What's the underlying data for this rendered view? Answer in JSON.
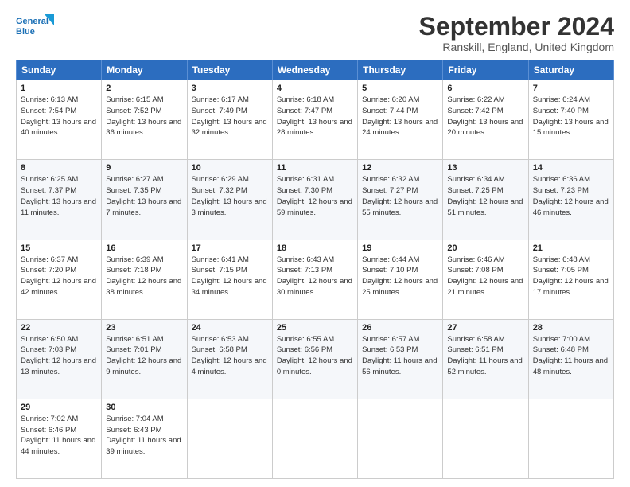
{
  "logo": {
    "line1": "General",
    "line2": "Blue"
  },
  "title": "September 2024",
  "location": "Ranskill, England, United Kingdom",
  "weekdays": [
    "Sunday",
    "Monday",
    "Tuesday",
    "Wednesday",
    "Thursday",
    "Friday",
    "Saturday"
  ],
  "weeks": [
    [
      {
        "day": "1",
        "sunrise": "Sunrise: 6:13 AM",
        "sunset": "Sunset: 7:54 PM",
        "daylight": "Daylight: 13 hours and 40 minutes."
      },
      {
        "day": "2",
        "sunrise": "Sunrise: 6:15 AM",
        "sunset": "Sunset: 7:52 PM",
        "daylight": "Daylight: 13 hours and 36 minutes."
      },
      {
        "day": "3",
        "sunrise": "Sunrise: 6:17 AM",
        "sunset": "Sunset: 7:49 PM",
        "daylight": "Daylight: 13 hours and 32 minutes."
      },
      {
        "day": "4",
        "sunrise": "Sunrise: 6:18 AM",
        "sunset": "Sunset: 7:47 PM",
        "daylight": "Daylight: 13 hours and 28 minutes."
      },
      {
        "day": "5",
        "sunrise": "Sunrise: 6:20 AM",
        "sunset": "Sunset: 7:44 PM",
        "daylight": "Daylight: 13 hours and 24 minutes."
      },
      {
        "day": "6",
        "sunrise": "Sunrise: 6:22 AM",
        "sunset": "Sunset: 7:42 PM",
        "daylight": "Daylight: 13 hours and 20 minutes."
      },
      {
        "day": "7",
        "sunrise": "Sunrise: 6:24 AM",
        "sunset": "Sunset: 7:40 PM",
        "daylight": "Daylight: 13 hours and 15 minutes."
      }
    ],
    [
      {
        "day": "8",
        "sunrise": "Sunrise: 6:25 AM",
        "sunset": "Sunset: 7:37 PM",
        "daylight": "Daylight: 13 hours and 11 minutes."
      },
      {
        "day": "9",
        "sunrise": "Sunrise: 6:27 AM",
        "sunset": "Sunset: 7:35 PM",
        "daylight": "Daylight: 13 hours and 7 minutes."
      },
      {
        "day": "10",
        "sunrise": "Sunrise: 6:29 AM",
        "sunset": "Sunset: 7:32 PM",
        "daylight": "Daylight: 13 hours and 3 minutes."
      },
      {
        "day": "11",
        "sunrise": "Sunrise: 6:31 AM",
        "sunset": "Sunset: 7:30 PM",
        "daylight": "Daylight: 12 hours and 59 minutes."
      },
      {
        "day": "12",
        "sunrise": "Sunrise: 6:32 AM",
        "sunset": "Sunset: 7:27 PM",
        "daylight": "Daylight: 12 hours and 55 minutes."
      },
      {
        "day": "13",
        "sunrise": "Sunrise: 6:34 AM",
        "sunset": "Sunset: 7:25 PM",
        "daylight": "Daylight: 12 hours and 51 minutes."
      },
      {
        "day": "14",
        "sunrise": "Sunrise: 6:36 AM",
        "sunset": "Sunset: 7:23 PM",
        "daylight": "Daylight: 12 hours and 46 minutes."
      }
    ],
    [
      {
        "day": "15",
        "sunrise": "Sunrise: 6:37 AM",
        "sunset": "Sunset: 7:20 PM",
        "daylight": "Daylight: 12 hours and 42 minutes."
      },
      {
        "day": "16",
        "sunrise": "Sunrise: 6:39 AM",
        "sunset": "Sunset: 7:18 PM",
        "daylight": "Daylight: 12 hours and 38 minutes."
      },
      {
        "day": "17",
        "sunrise": "Sunrise: 6:41 AM",
        "sunset": "Sunset: 7:15 PM",
        "daylight": "Daylight: 12 hours and 34 minutes."
      },
      {
        "day": "18",
        "sunrise": "Sunrise: 6:43 AM",
        "sunset": "Sunset: 7:13 PM",
        "daylight": "Daylight: 12 hours and 30 minutes."
      },
      {
        "day": "19",
        "sunrise": "Sunrise: 6:44 AM",
        "sunset": "Sunset: 7:10 PM",
        "daylight": "Daylight: 12 hours and 25 minutes."
      },
      {
        "day": "20",
        "sunrise": "Sunrise: 6:46 AM",
        "sunset": "Sunset: 7:08 PM",
        "daylight": "Daylight: 12 hours and 21 minutes."
      },
      {
        "day": "21",
        "sunrise": "Sunrise: 6:48 AM",
        "sunset": "Sunset: 7:05 PM",
        "daylight": "Daylight: 12 hours and 17 minutes."
      }
    ],
    [
      {
        "day": "22",
        "sunrise": "Sunrise: 6:50 AM",
        "sunset": "Sunset: 7:03 PM",
        "daylight": "Daylight: 12 hours and 13 minutes."
      },
      {
        "day": "23",
        "sunrise": "Sunrise: 6:51 AM",
        "sunset": "Sunset: 7:01 PM",
        "daylight": "Daylight: 12 hours and 9 minutes."
      },
      {
        "day": "24",
        "sunrise": "Sunrise: 6:53 AM",
        "sunset": "Sunset: 6:58 PM",
        "daylight": "Daylight: 12 hours and 4 minutes."
      },
      {
        "day": "25",
        "sunrise": "Sunrise: 6:55 AM",
        "sunset": "Sunset: 6:56 PM",
        "daylight": "Daylight: 12 hours and 0 minutes."
      },
      {
        "day": "26",
        "sunrise": "Sunrise: 6:57 AM",
        "sunset": "Sunset: 6:53 PM",
        "daylight": "Daylight: 11 hours and 56 minutes."
      },
      {
        "day": "27",
        "sunrise": "Sunrise: 6:58 AM",
        "sunset": "Sunset: 6:51 PM",
        "daylight": "Daylight: 11 hours and 52 minutes."
      },
      {
        "day": "28",
        "sunrise": "Sunrise: 7:00 AM",
        "sunset": "Sunset: 6:48 PM",
        "daylight": "Daylight: 11 hours and 48 minutes."
      }
    ],
    [
      {
        "day": "29",
        "sunrise": "Sunrise: 7:02 AM",
        "sunset": "Sunset: 6:46 PM",
        "daylight": "Daylight: 11 hours and 44 minutes."
      },
      {
        "day": "30",
        "sunrise": "Sunrise: 7:04 AM",
        "sunset": "Sunset: 6:43 PM",
        "daylight": "Daylight: 11 hours and 39 minutes."
      },
      null,
      null,
      null,
      null,
      null
    ]
  ]
}
